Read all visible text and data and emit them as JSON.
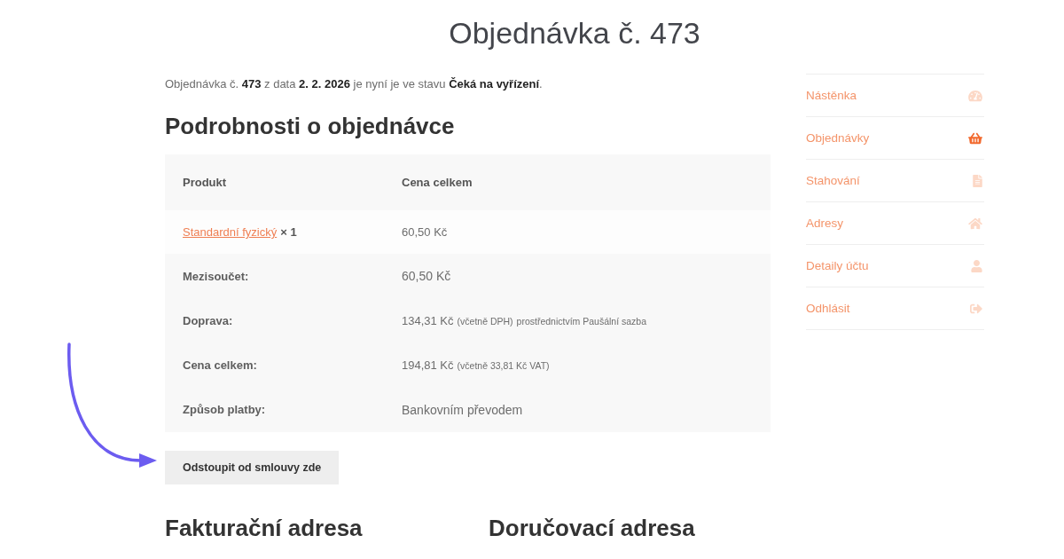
{
  "page": {
    "title": "Objednávka č. 473"
  },
  "intro": "Objednávka č. **473** z data **2. 2. 2026** je nyní je ve stavu **Čeká na vyřízení**.",
  "order_details": {
    "heading": "Podrobnosti o objednávce",
    "columns": [
      "Produkt",
      "Cena celkem"
    ],
    "items": [
      {
        "product": "Standardní fyzický",
        "quantity": "× 1",
        "total": "60,50 Kč"
      }
    ],
    "totals": [
      {
        "label": "Mezisoučet:",
        "value": "60,50 Kč"
      },
      {
        "label": "Doprava:",
        "value": "134,31 Kč",
        "notes": [
          "(včetně DPH)",
          "prostřednictvím Paušální sazba"
        ]
      },
      {
        "label": "Cena celkem:",
        "value": "194,81 Kč",
        "notes": [
          "(včetně 33,81 Kč VAT)"
        ]
      },
      {
        "label": "Způsob platby:",
        "value": "Bankovním převodem"
      }
    ]
  },
  "withdraw_button": "Odstoupit od smlouvy zde",
  "addresses": [
    {
      "heading": "Fakturační adresa"
    },
    {
      "heading": "Doručovací adresa"
    }
  ],
  "sidebar": {
    "items": [
      {
        "label": "Nástěnka",
        "selected": false
      },
      {
        "label": "Objednávky",
        "selected": true
      },
      {
        "label": "Stahování",
        "selected": false
      },
      {
        "label": "Adresy",
        "selected": false
      },
      {
        "label": "Detaily účtu",
        "selected": false
      },
      {
        "label": "Odhlásit",
        "selected": false
      }
    ]
  }
}
